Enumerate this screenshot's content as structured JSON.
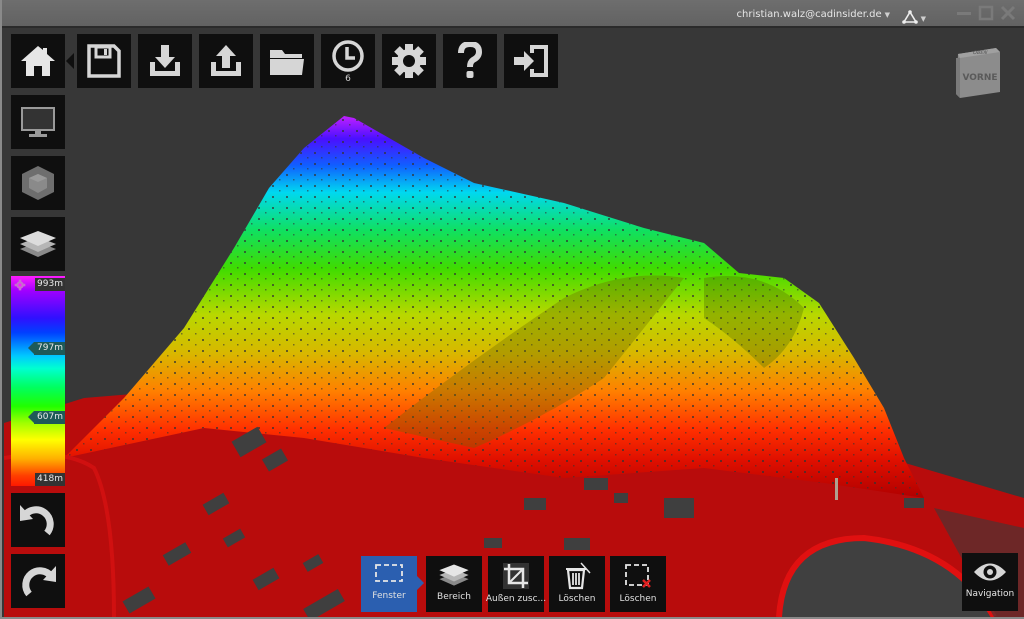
{
  "titlebar": {
    "user_email": "christian.walz@cadinsider.de",
    "network_icon": "network-triangle-icon",
    "window_controls": [
      "minimize-icon",
      "maximize-icon",
      "close-icon"
    ]
  },
  "toolbar": {
    "items": [
      {
        "id": "home",
        "icon": "home-icon"
      },
      {
        "id": "save",
        "icon": "floppy-disk-icon"
      },
      {
        "id": "import",
        "icon": "download-tray-icon"
      },
      {
        "id": "export",
        "icon": "upload-tray-icon"
      },
      {
        "id": "open",
        "icon": "folder-icon"
      },
      {
        "id": "history",
        "icon": "clock-icon",
        "count": "6"
      },
      {
        "id": "settings",
        "icon": "gear-icon"
      },
      {
        "id": "help",
        "icon": "question-mark-icon"
      },
      {
        "id": "exit",
        "icon": "sign-out-icon"
      }
    ]
  },
  "sidebar": {
    "items": [
      {
        "id": "display",
        "icon": "monitor-icon"
      },
      {
        "id": "object",
        "icon": "cube-icon"
      },
      {
        "id": "layers",
        "icon": "layers-icon"
      }
    ],
    "undo_icon": "undo-arrow-icon",
    "redo_icon": "redo-arrow-icon"
  },
  "elevation_legend": {
    "max_label": "993m",
    "upper_label": "797m",
    "lower_label": "607m",
    "min_label": "418m",
    "settings_icon": "gear-icon",
    "colors": [
      "#ff1cff",
      "#3010ff",
      "#00c8ff",
      "#00ff60",
      "#ffff00",
      "#ff1800"
    ]
  },
  "view_cube": {
    "top_face": "OBEN",
    "front_face": "VORNE"
  },
  "bottom_toolbar": {
    "items": [
      {
        "id": "fenster",
        "label": "Fenster",
        "icon": "dashed-rectangle-icon",
        "active": true
      },
      {
        "id": "bereich",
        "label": "Bereich",
        "icon": "layers-icon",
        "active": false
      },
      {
        "id": "aussen",
        "label": "Außen zusc...",
        "icon": "crop-icon",
        "active": false
      },
      {
        "id": "loeschen1",
        "label": "Löschen",
        "icon": "trash-icon",
        "active": false
      },
      {
        "id": "loeschen2",
        "label": "Löschen",
        "icon": "dashed-rectangle-x-icon",
        "active": false
      }
    ]
  },
  "navigation": {
    "label": "Navigation",
    "icon": "eye-icon"
  },
  "scene": {
    "background": "#373737",
    "description": "3D point cloud terrain colored by elevation"
  }
}
